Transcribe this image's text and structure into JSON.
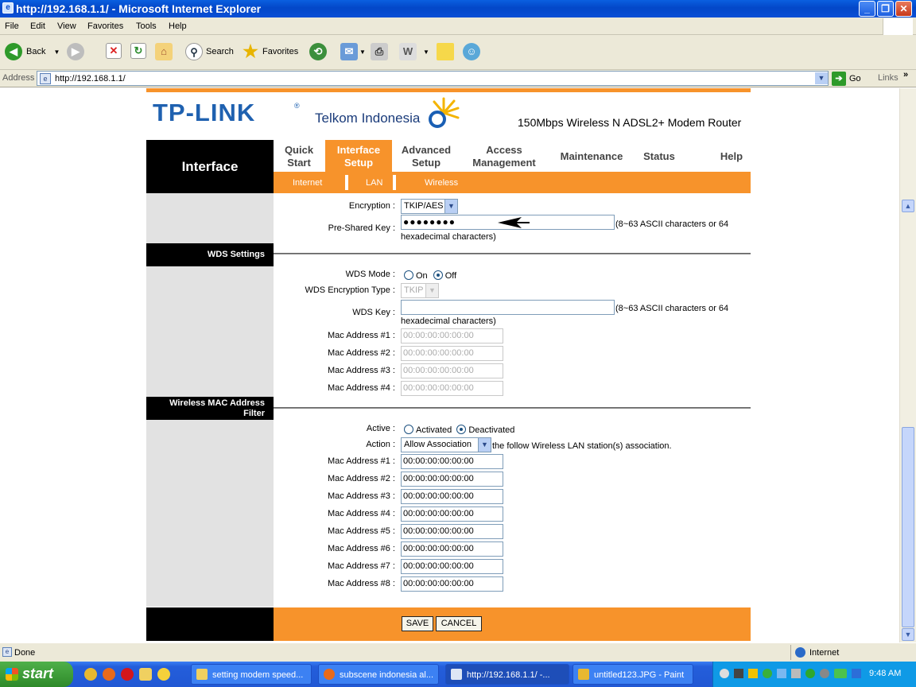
{
  "window": {
    "title": "http://192.168.1.1/ - Microsoft Internet Explorer"
  },
  "menu": [
    "File",
    "Edit",
    "View",
    "Favorites",
    "Tools",
    "Help"
  ],
  "toolbar": {
    "back": "Back",
    "search": "Search",
    "favorites": "Favorites"
  },
  "address": {
    "label": "Address",
    "url": "http://192.168.1.1/",
    "go": "Go",
    "links": "Links"
  },
  "header": {
    "logo": "TP-LINK",
    "partner": "Telkom Indonesia",
    "model": "150Mbps Wireless N ADSL2+ Modem Router"
  },
  "nav": {
    "section": "Interface",
    "tabs": [
      {
        "l1": "Quick",
        "l2": "Start"
      },
      {
        "l1": "Interface",
        "l2": "Setup"
      },
      {
        "l1": "Advanced",
        "l2": "Setup"
      },
      {
        "l1": "Access",
        "l2": "Management"
      },
      {
        "l1": "Maintenance",
        "l2": ""
      },
      {
        "l1": "Status",
        "l2": ""
      },
      {
        "l1": "Help",
        "l2": ""
      }
    ],
    "sub": [
      "Internet",
      "LAN",
      "Wireless"
    ]
  },
  "security": {
    "encryption_label": "Encryption :",
    "encryption_value": "TKIP/AES",
    "psk_label": "Pre-Shared Key :",
    "psk_value": "●●●●●●●●",
    "psk_hint": "(8~63 ASCII characters or 64",
    "psk_hint2": "hexadecimal characters)"
  },
  "wds": {
    "title": "WDS Settings",
    "mode_label": "WDS Mode :",
    "on": "On",
    "off": "Off",
    "enc_label": "WDS Encryption Type :",
    "enc_value": "TKIP",
    "key_label": "WDS Key :",
    "key_hint": "(8~63 ASCII characters or 64",
    "key_hint2": "hexadecimal characters)",
    "macs": [
      {
        "label": "Mac Address #1 :",
        "value": "00:00:00:00:00:00"
      },
      {
        "label": "Mac Address #2 :",
        "value": "00:00:00:00:00:00"
      },
      {
        "label": "Mac Address #3 :",
        "value": "00:00:00:00:00:00"
      },
      {
        "label": "Mac Address #4 :",
        "value": "00:00:00:00:00:00"
      }
    ]
  },
  "macfilter": {
    "title1": "Wireless MAC Address",
    "title2": "Filter",
    "active_label": "Active :",
    "activated": "Activated",
    "deactivated": "Deactivated",
    "action_label": "Action :",
    "action_value": "Allow Association",
    "action_suffix": "the follow Wireless LAN station(s) association.",
    "macs": [
      {
        "label": "Mac Address #1 :",
        "value": "00:00:00:00:00:00"
      },
      {
        "label": "Mac Address #2 :",
        "value": "00:00:00:00:00:00"
      },
      {
        "label": "Mac Address #3 :",
        "value": "00:00:00:00:00:00"
      },
      {
        "label": "Mac Address #4 :",
        "value": "00:00:00:00:00:00"
      },
      {
        "label": "Mac Address #5 :",
        "value": "00:00:00:00:00:00"
      },
      {
        "label": "Mac Address #6 :",
        "value": "00:00:00:00:00:00"
      },
      {
        "label": "Mac Address #7 :",
        "value": "00:00:00:00:00:00"
      },
      {
        "label": "Mac Address #8 :",
        "value": "00:00:00:00:00:00"
      }
    ]
  },
  "buttons": {
    "save": "SAVE",
    "cancel": "CANCEL"
  },
  "status": {
    "left": "Done",
    "zone": "Internet"
  },
  "taskbar": {
    "start": "start",
    "tasks": [
      "setting modem speed...",
      "subscene indonesia al...",
      "http://192.168.1.1/ -...",
      "untitled123.JPG - Paint"
    ],
    "clock": "9:48 AM"
  },
  "colors": {
    "accent": "#f7932b",
    "brand": "#1f61b0"
  }
}
